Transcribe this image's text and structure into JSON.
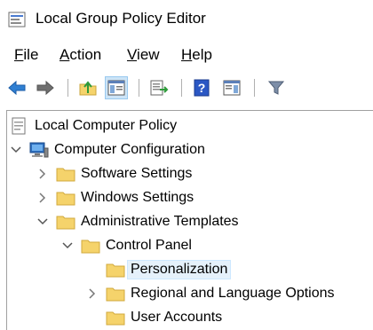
{
  "window": {
    "title": "Local Group Policy Editor"
  },
  "menu": [
    {
      "pre": "",
      "ul": "F",
      "post": "ile"
    },
    {
      "pre": "",
      "ul": "A",
      "post": "ction"
    },
    {
      "pre": "",
      "ul": "V",
      "post": "iew"
    },
    {
      "pre": "",
      "ul": "H",
      "post": "elp"
    }
  ],
  "toolbar": {
    "icons": [
      "back-arrow-icon",
      "forward-arrow-icon",
      "up-folder-icon",
      "show-hide-tree-icon",
      "export-list-icon",
      "help-icon",
      "show-hide-action-pane-icon",
      "filter-icon"
    ]
  },
  "tree": {
    "root": "Local Computer Policy",
    "computer_configuration": "Computer Configuration",
    "software_settings": "Software Settings",
    "windows_settings": "Windows Settings",
    "administrative_templates": "Administrative Templates",
    "control_panel": "Control Panel",
    "personalization": "Personalization",
    "regional_language": "Regional and Language Options",
    "user_accounts": "User Accounts"
  },
  "colors": {
    "selection": "#e5f1fb",
    "folder": "#f5d36b"
  }
}
